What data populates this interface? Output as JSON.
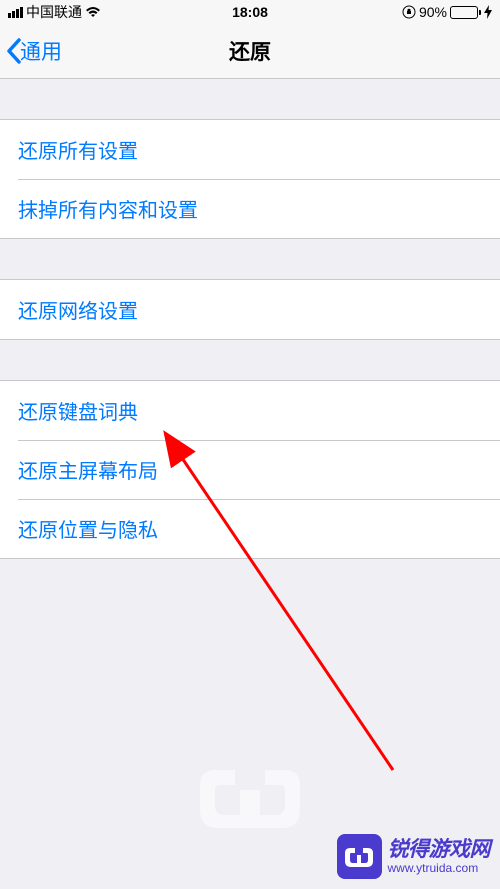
{
  "statusBar": {
    "carrier": "中国联通",
    "time": "18:08",
    "battery": "90%"
  },
  "nav": {
    "back": "通用",
    "title": "还原"
  },
  "groups": [
    {
      "rows": [
        {
          "label": "还原所有设置"
        },
        {
          "label": "抹掉所有内容和设置"
        }
      ]
    },
    {
      "rows": [
        {
          "label": "还原网络设置"
        }
      ]
    },
    {
      "rows": [
        {
          "label": "还原键盘词典"
        },
        {
          "label": "还原主屏幕布局"
        },
        {
          "label": "还原位置与隐私"
        }
      ]
    }
  ],
  "watermark": {
    "title": "锐得游戏网",
    "url": "www.ytruida.com"
  }
}
